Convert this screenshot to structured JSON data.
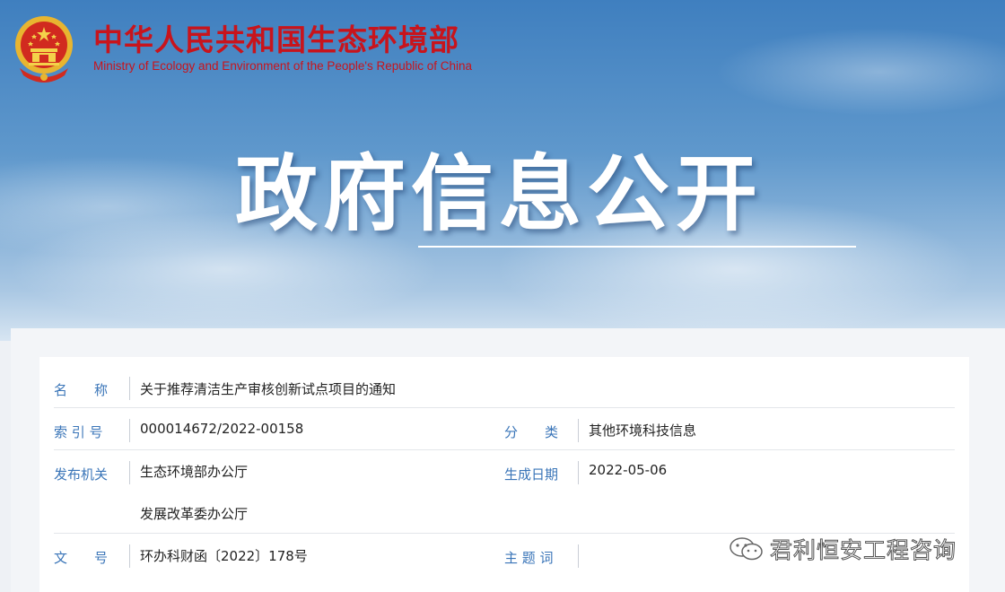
{
  "header": {
    "ministry_cn": "中华人民共和国生态环境部",
    "ministry_en": "Ministry of Ecology and Environment of the People's Republic of China",
    "banner_title": "政府信息公开"
  },
  "info": {
    "name_label": "名　　称",
    "name_value": "关于推荐清洁生产审核创新试点项目的通知",
    "index_label": "索 引 号",
    "index_value": "000014672/2022-00158",
    "category_label": "分　　类",
    "category_value": "其他环境科技信息",
    "publisher_label": "发布机关",
    "publisher_value_1": "生态环境部办公厅",
    "publisher_value_2": "发展改革委办公厅",
    "date_label": "生成日期",
    "date_value": "2022-05-06",
    "docno_label": "文　　号",
    "docno_value": "环办科财函〔2022〕178号",
    "keywords_label": "主 题 词",
    "keywords_value": ""
  },
  "watermark": {
    "text": "君利恒安工程咨询",
    "icon": "wechat-icon"
  },
  "colors": {
    "brand_red": "#c8141c",
    "label_blue": "#3a75b8"
  }
}
